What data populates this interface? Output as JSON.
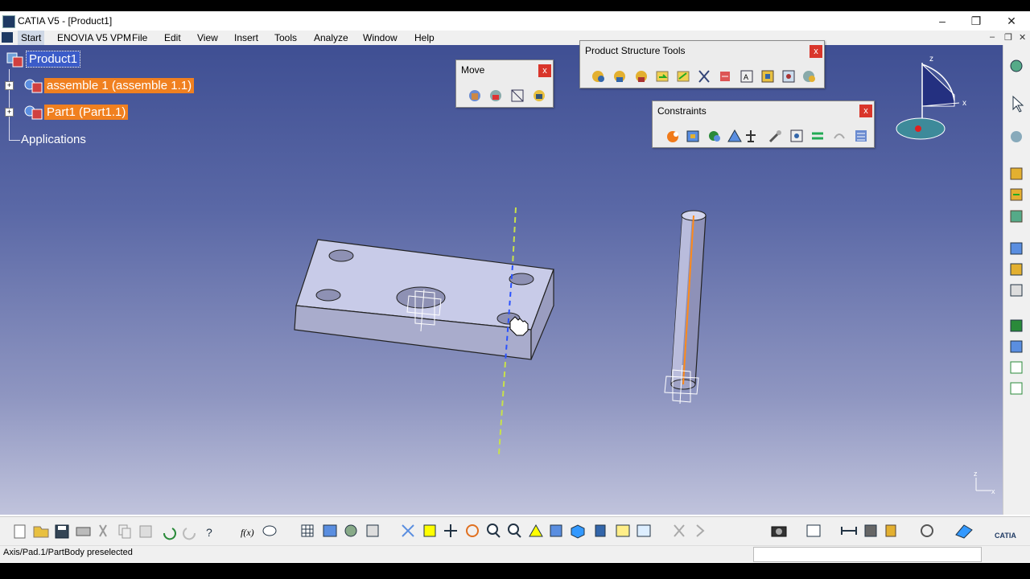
{
  "window": {
    "title": "CATIA V5 - [Product1]",
    "minimize_glyph": "–",
    "restore_glyph": "❐",
    "close_glyph": "✕"
  },
  "menu": {
    "items": [
      "Start",
      "ENOVIA V5 VPM",
      "File",
      "Edit",
      "View",
      "Insert",
      "Tools",
      "Analyze",
      "Window",
      "Help"
    ]
  },
  "tree": {
    "root": "Product1",
    "children": [
      "assemble 1 (assemble 1.1)",
      "Part1 (Part1.1)"
    ],
    "applications": "Applications"
  },
  "toolbars": {
    "move": {
      "title": "Move",
      "close": "x"
    },
    "product_structure": {
      "title": "Product Structure Tools",
      "close": "x"
    },
    "constraints": {
      "title": "Constraints",
      "close": "x"
    }
  },
  "compass": {
    "z_label": "z",
    "x_label": "x"
  },
  "small_axis": {
    "x_label": "x",
    "z_label": "z"
  },
  "status": {
    "message": "Axis/Pad.1/PartBody preselected",
    "input_value": ""
  },
  "colors": {
    "tree_highlight_blue": "#3b5cc9",
    "tree_highlight_orange": "#f08020",
    "close_red": "#d9362b",
    "axis_green": "#c8e24a",
    "axis_blue": "#2a52ff",
    "edge_orange": "#ff8a1a"
  },
  "icons": {
    "tree_product": "product-icon",
    "tree_component": "component-icon",
    "cursor": "hand-cursor-icon"
  }
}
